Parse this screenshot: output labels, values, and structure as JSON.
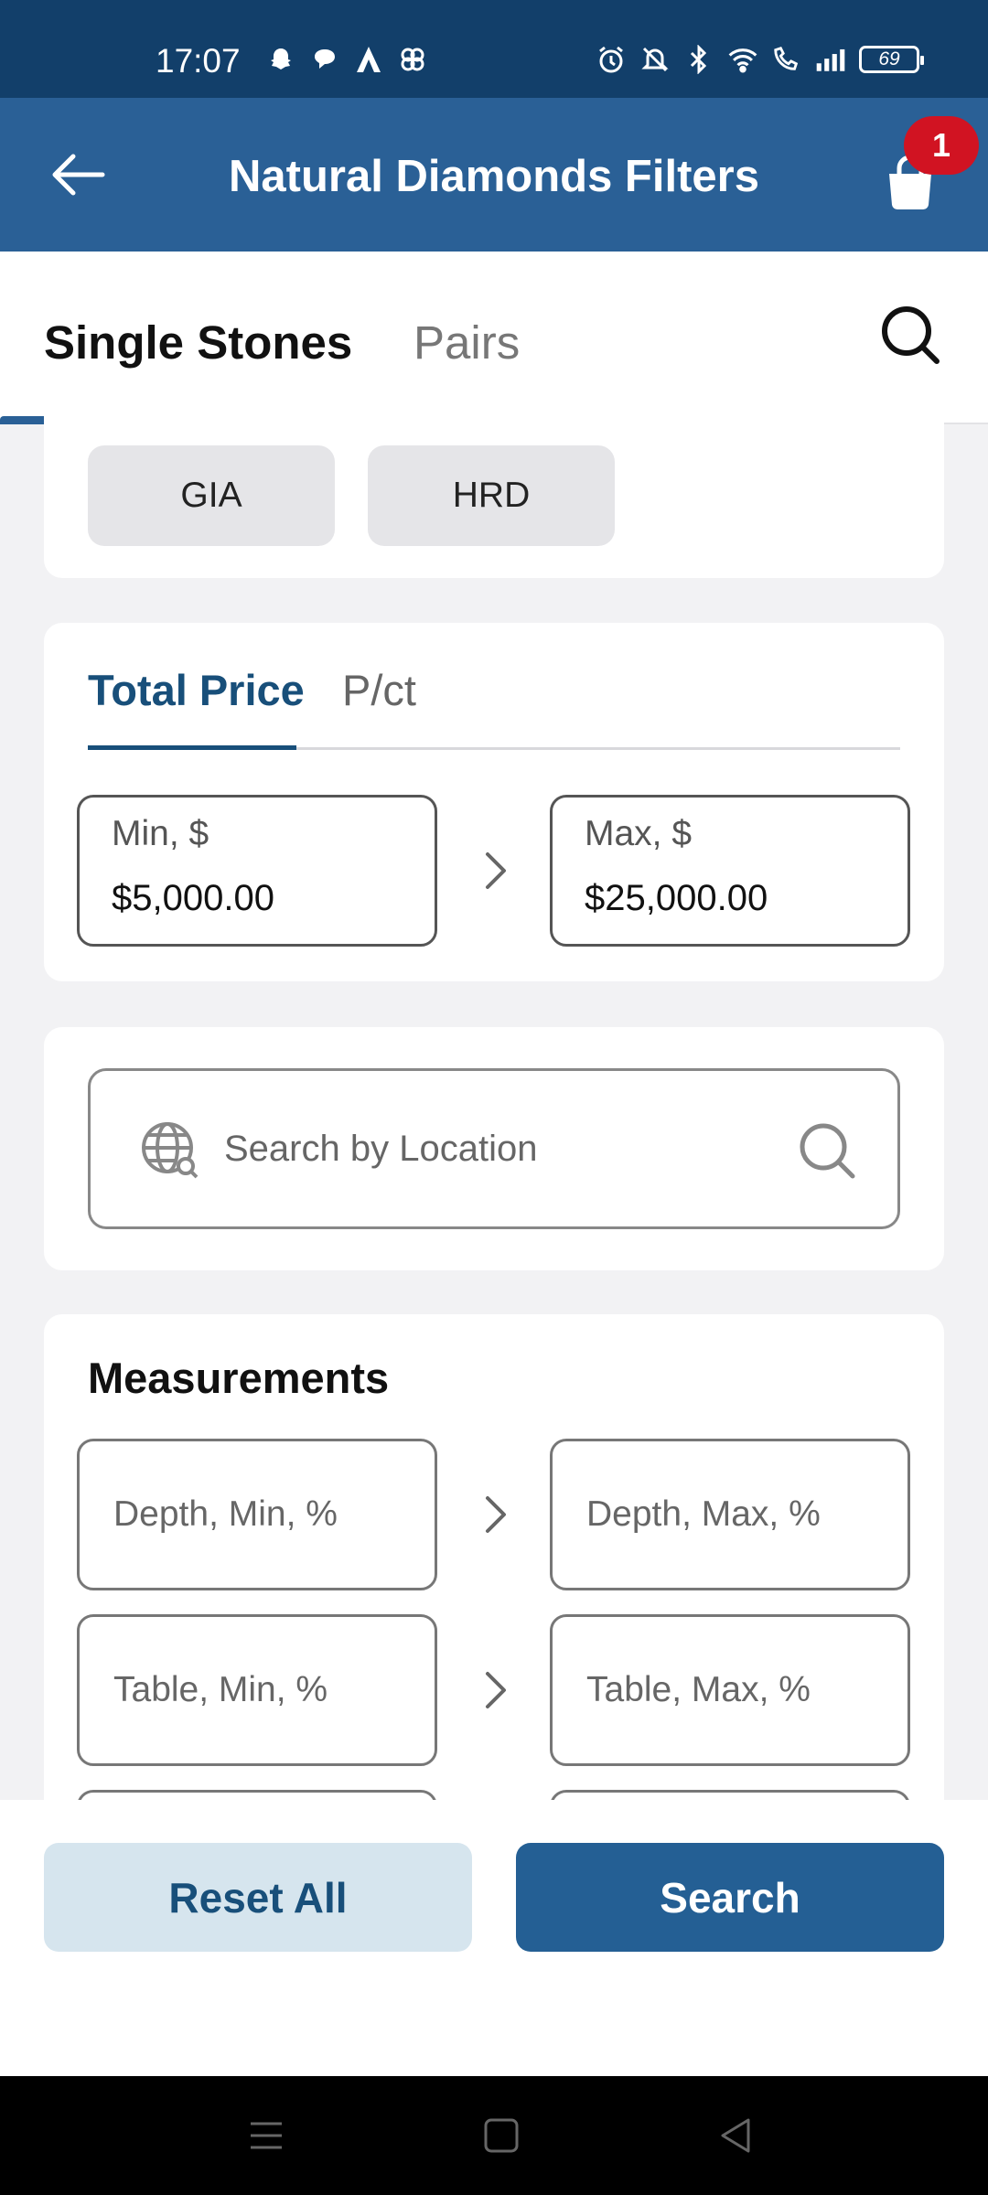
{
  "status_bar": {
    "time": "17:07",
    "battery": "69",
    "left_icons": [
      "snapchat-icon",
      "chat-icon",
      "a-icon",
      "pinwheel-icon"
    ],
    "right_icons": [
      "alarm-icon",
      "mute-icon",
      "bluetooth-icon",
      "wifi-icon",
      "wifi-call-icon",
      "signal-icon",
      "battery-icon"
    ]
  },
  "app_bar": {
    "title": "Natural Diamonds Filters",
    "cart_count": "1"
  },
  "tabs": [
    {
      "label": "Single Stones",
      "active": true
    },
    {
      "label": "Pairs",
      "active": false
    }
  ],
  "lab_chips": [
    "GIA",
    "HRD"
  ],
  "price": {
    "tabs": [
      {
        "label": "Total Price",
        "active": true
      },
      {
        "label": "P/ct",
        "active": false
      }
    ],
    "min_label": "Min, $",
    "min_value": "$5,000.00",
    "max_label": "Max, $",
    "max_value": "$25,000.00"
  },
  "location": {
    "placeholder": "Search by Location"
  },
  "measurements": {
    "title": "Measurements",
    "depth_min": "Depth, Min, %",
    "depth_max": "Depth, Max, %",
    "table_min": "Table, Min, %",
    "table_max": "Table, Max, %"
  },
  "actions": {
    "reset": "Reset All",
    "search": "Search"
  },
  "colors": {
    "status_bar": "#123f6a",
    "app_bar": "#2a6096",
    "accent": "#184f7a",
    "badge": "#d11322",
    "reset_bg": "#d6e5ee"
  }
}
